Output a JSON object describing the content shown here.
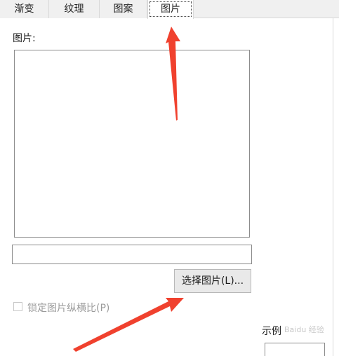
{
  "tabs": [
    {
      "label": "渐变",
      "active": false
    },
    {
      "label": "纹理",
      "active": false
    },
    {
      "label": "图案",
      "active": false
    },
    {
      "label": "图片",
      "active": true
    }
  ],
  "picture_label": "图片:",
  "picture_path_value": "",
  "select_button_label": "选择图片(L)...",
  "lock_aspect": {
    "label": "锁定图片纵横比(P)",
    "checked": false,
    "enabled": false
  },
  "sample_label": "示例",
  "watermark_text": "Baidu 经验",
  "colors": {
    "annotation_arrow": "#f0412e",
    "tab_bg": "#f0f0f0",
    "border": "#8c8c8c"
  }
}
